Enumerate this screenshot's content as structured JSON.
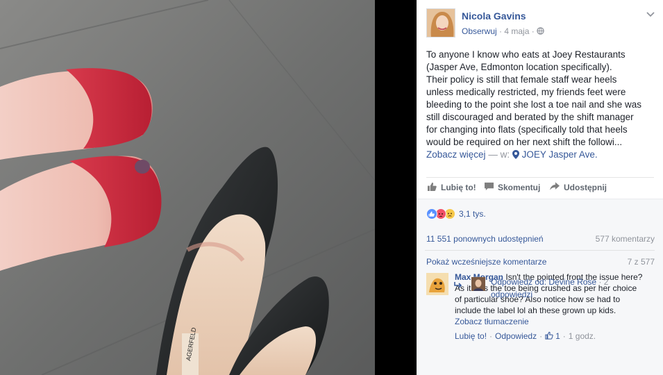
{
  "post": {
    "author": "Nicola Gavins",
    "follow_label": "Obserwuj",
    "date": "4 maja",
    "separator": "·",
    "visibility_icon": "globe-icon",
    "menu_icon": "chevron-down-icon",
    "text_lines": [
      "To anyone I know who eats at Joey Restaurants",
      "(Jasper Ave, Edmonton location specifically).",
      "Their policy is still that female staff wear heels",
      "unless medically restricted, my friends feet were",
      "bleeding to the point she lost a toe nail and she was",
      "still discouraged and berated by the shift manager",
      "for changing into flats (specifically told that heels",
      "would be required on her next shift the followi..."
    ],
    "see_more": "Zobacz więcej",
    "location_prefix": "— w:",
    "location": "JOEY Jasper Ave."
  },
  "actions": {
    "like": "Lubię to!",
    "comment": "Skomentuj",
    "share": "Udostępnij"
  },
  "reactions": {
    "count": "3,1 tys.",
    "types": [
      "like",
      "angry",
      "sad"
    ]
  },
  "stats": {
    "shares": "11 551 ponownych udostępnień",
    "comments": "577 komentarzy"
  },
  "comments_section": {
    "show_previous": "Pokaż wcześniejsze komentarze",
    "counter": "7 z 577"
  },
  "comment": {
    "author": "Max Morgan",
    "text_lines": [
      "Isn't the pointed front the issue here?",
      "As it was the toe being crushed as per her choice",
      "of particular shoe? Also notice how se had to",
      "include the label lol ah these grown up kids."
    ],
    "translate": "Zobacz tłumaczenie",
    "like": "Lubię to!",
    "reply": "Odpowiedz",
    "like_count": "1",
    "time": "1 godz."
  },
  "reply_summary": {
    "label": "Odpowiedź od: Devine Rose",
    "suffix": "· 2",
    "suffix2": "odpowiedzi"
  },
  "colors": {
    "link": "#365899",
    "text": "#1d2129",
    "muted": "#90949c",
    "action": "#606770",
    "panel_bg": "#ffffff",
    "stats_bg": "#f6f7f9"
  }
}
